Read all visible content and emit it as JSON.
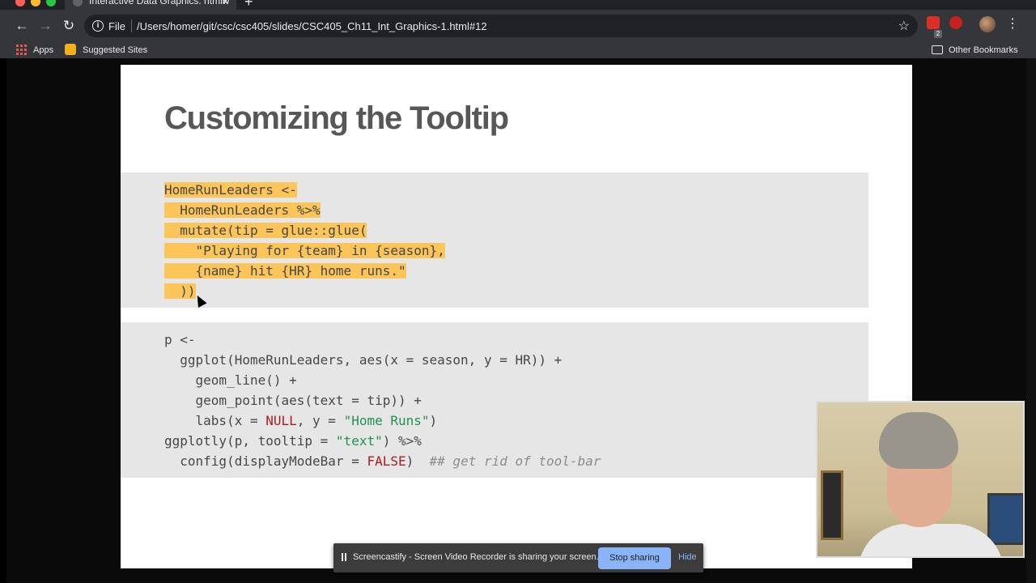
{
  "browser": {
    "tab_title": "Interactive Data Graphics: htmlw",
    "file_label": "File",
    "url": "/Users/homer/git/csc/csc405/slides/CSC405_Ch11_Int_Graphics-1.html#12",
    "extension_badge": "2",
    "bookmarks": {
      "apps": "Apps",
      "suggested": "Suggested Sites",
      "other": "Other Bookmarks"
    }
  },
  "slide": {
    "title": "Customizing the Tooltip",
    "code_block_1": [
      "HomeRunLeaders <-",
      "  HomeRunLeaders %>%",
      "  mutate(tip = glue::glue(",
      "    \"Playing for {team} in {season},",
      "    {name} hit {HR} home runs.\"",
      "  ))"
    ],
    "code_block_2": {
      "l1": "p <-",
      "l2": "  ggplot(HomeRunLeaders, aes(x = season, y = HR)) +",
      "l3": "    geom_line() +",
      "l4": "    geom_point(aes(text = tip)) +",
      "l5a": "    labs(x = ",
      "l5b": "NULL",
      "l5c": ", y = ",
      "l5d": "\"Home Runs\"",
      "l5e": ")",
      "l6a": "ggplotly(p, tooltip = ",
      "l6b": "\"text\"",
      "l6c": ") %>%",
      "l7a": "  config(displayModeBar = ",
      "l7b": "FALSE",
      "l7c": ")  ",
      "l7d": "## get rid of tool-bar"
    }
  },
  "sharebar": {
    "message": "Screencastify - Screen Video Recorder is sharing your screen.",
    "stop_label": "Stop sharing",
    "hide_label": "Hide"
  },
  "icons": {
    "back": "back-arrow-icon",
    "forward": "forward-arrow-icon",
    "reload": "reload-icon",
    "bookmark_star": "star-icon",
    "menu": "more-vert-icon"
  },
  "colors": {
    "highlight": "#fbc55a",
    "code_bg": "#e6e6e6",
    "string": "#219150",
    "keyword": "#a42020",
    "stop_button": "#8ab4f8"
  }
}
